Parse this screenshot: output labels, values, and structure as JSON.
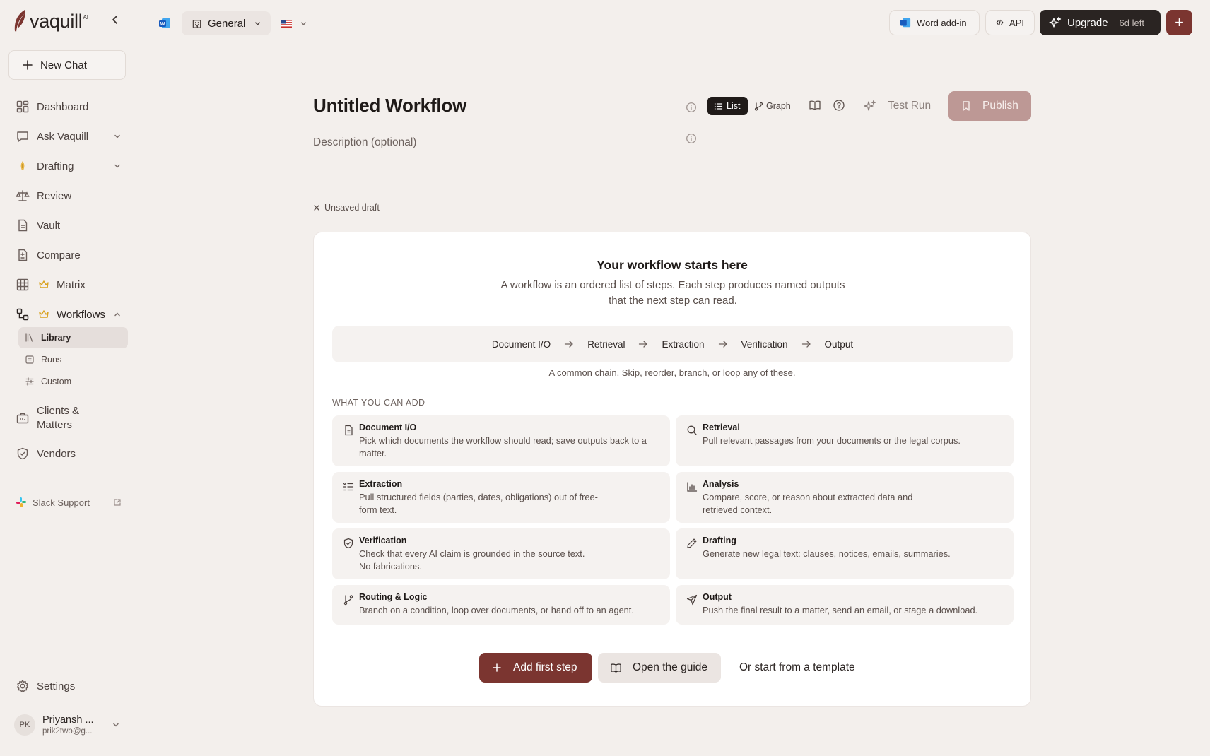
{
  "brand": {
    "name": "vaquill",
    "ai_badge": "AI"
  },
  "sidebar": {
    "new_chat": "New Chat",
    "items": [
      {
        "label": "Dashboard"
      },
      {
        "label": "Ask Vaquill"
      },
      {
        "label": "Drafting"
      },
      {
        "label": "Review"
      },
      {
        "label": "Vault"
      },
      {
        "label": "Compare"
      },
      {
        "label": "Matrix"
      },
      {
        "label": "Workflows"
      },
      {
        "label": "Clients & Matters"
      },
      {
        "label": "Vendors"
      }
    ],
    "workflow_sub": [
      {
        "label": "Library"
      },
      {
        "label": "Runs"
      },
      {
        "label": "Custom"
      }
    ],
    "slack": "Slack Support",
    "settings": "Settings",
    "user": {
      "initials": "PK",
      "name": "Priyansh ...",
      "email": "prik2two@g..."
    }
  },
  "topbar": {
    "workspace": "General",
    "word_addin": "Word add-in",
    "api": "API",
    "upgrade": "Upgrade",
    "days_left": "6d left",
    "plus": "+"
  },
  "header": {
    "title": "Untitled Workflow",
    "description_placeholder": "Description (optional)",
    "view_list": "List",
    "view_graph": "Graph",
    "test_run": "Test Run",
    "publish": "Publish",
    "unsaved": "Unsaved draft"
  },
  "card": {
    "title": "Your workflow starts here",
    "subtitle": "A workflow is an ordered list of steps. Each step produces named outputs that the next step can read.",
    "chain": [
      "Document I/O",
      "Retrieval",
      "Extraction",
      "Verification",
      "Output"
    ],
    "chain_note": "A common chain. Skip, reorder, branch, or loop any of these.",
    "section_label": "WHAT YOU CAN ADD",
    "tiles": [
      {
        "title": "Document I/O",
        "desc": "Pick which documents the workflow should read; save outputs back to a matter.",
        "icon": "document-icon"
      },
      {
        "title": "Retrieval",
        "desc": "Pull relevant passages from your documents or the legal corpus.",
        "icon": "search-icon"
      },
      {
        "title": "Extraction",
        "desc": "Pull structured fields (parties, dates, obligations) out of free-\nform text.",
        "icon": "checklist-icon"
      },
      {
        "title": "Analysis",
        "desc": "Compare, score, or reason about extracted data and\nretrieved context.",
        "icon": "bar-chart-icon"
      },
      {
        "title": "Verification",
        "desc": "Check that every AI claim is grounded in the source text.\nNo fabrications.",
        "icon": "shield-check-icon"
      },
      {
        "title": "Drafting",
        "desc": "Generate new legal text: clauses, notices, emails, summaries.",
        "icon": "pen-icon"
      },
      {
        "title": "Routing & Logic",
        "desc": "Branch on a condition, loop over documents, or hand off to an agent.",
        "icon": "branch-icon"
      },
      {
        "title": "Output",
        "desc": "Push the final result to a matter, send an email, or stage a download.",
        "icon": "send-icon"
      }
    ],
    "add_first_step": "Add first step",
    "open_guide": "Open the guide",
    "template": "Or start from a template"
  },
  "colors": {
    "accent": "#7b3530",
    "publish_disabled": "#bd9895",
    "dark": "#2a2422",
    "background": "#f3efec"
  }
}
